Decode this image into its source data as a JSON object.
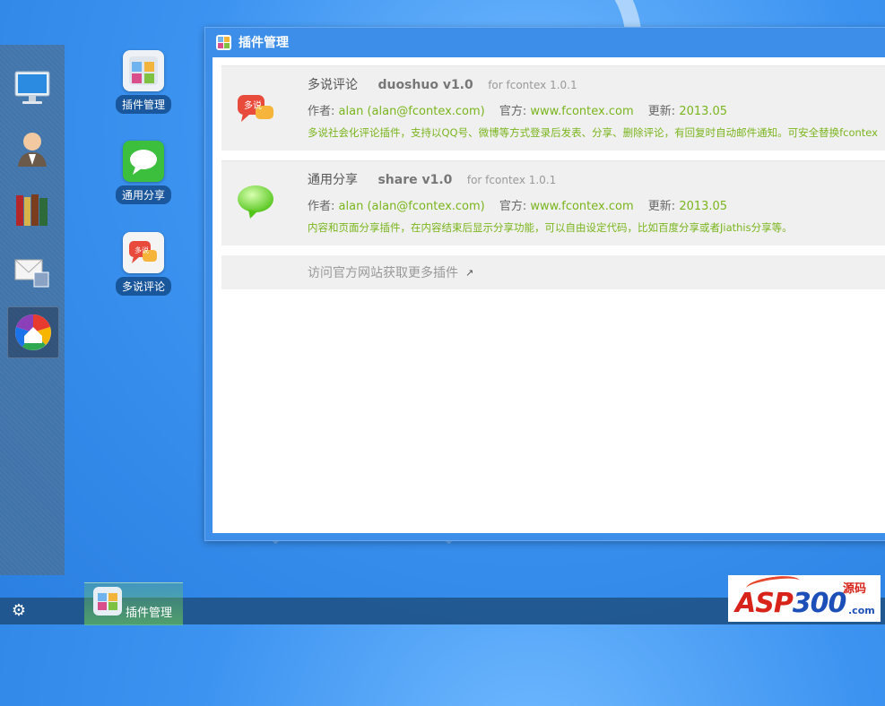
{
  "desktop": {
    "icons": [
      {
        "label": "插件管理",
        "icon": "plugin-manager-icon"
      },
      {
        "label": "通用分享",
        "icon": "share-bubble-icon"
      },
      {
        "label": "多说评论",
        "icon": "duoshuo-icon"
      }
    ]
  },
  "dock": {
    "items": [
      "monitor-icon",
      "user-icon",
      "books-icon",
      "mail-icon",
      "picasa-icon"
    ],
    "active_index": 4
  },
  "window": {
    "title": "插件管理",
    "plugins": [
      {
        "name": "多说评论",
        "version": "duoshuo v1.0",
        "for": "for fcontex 1.0.1",
        "author_label": "作者:",
        "author": "alan (alan@fcontex.com)",
        "site_label": "官方:",
        "site": "www.fcontex.com",
        "updated_label": "更新:",
        "updated": "2013.05",
        "description": "多说社会化评论插件，支持以QQ号、微博等方式登录后发表、分享、删除评论，有回复时自动邮件通知。可安全替换fcontex"
      },
      {
        "name": "通用分享",
        "version": "share v1.0",
        "for": "for fcontex 1.0.1",
        "author_label": "作者:",
        "author": "alan (alan@fcontex.com)",
        "site_label": "官方:",
        "site": "www.fcontex.com",
        "updated_label": "更新:",
        "updated": "2013.05",
        "description": "内容和页面分享插件，在内容结束后显示分享功能，可以自由设定代码，比如百度分享或者Jiathis分享等。"
      }
    ],
    "more_link": "访问官方网站获取更多插件"
  },
  "taskbar": {
    "task_label": "插件管理"
  },
  "watermark": {
    "brand_asp": "ASP",
    "brand_num": "300",
    "brand_cn": "源码",
    "brand_com": ".com"
  },
  "colors": {
    "accent_green": "#7ab51d",
    "window_blue": "#3d8ee8",
    "brand_red": "#d8231a"
  }
}
